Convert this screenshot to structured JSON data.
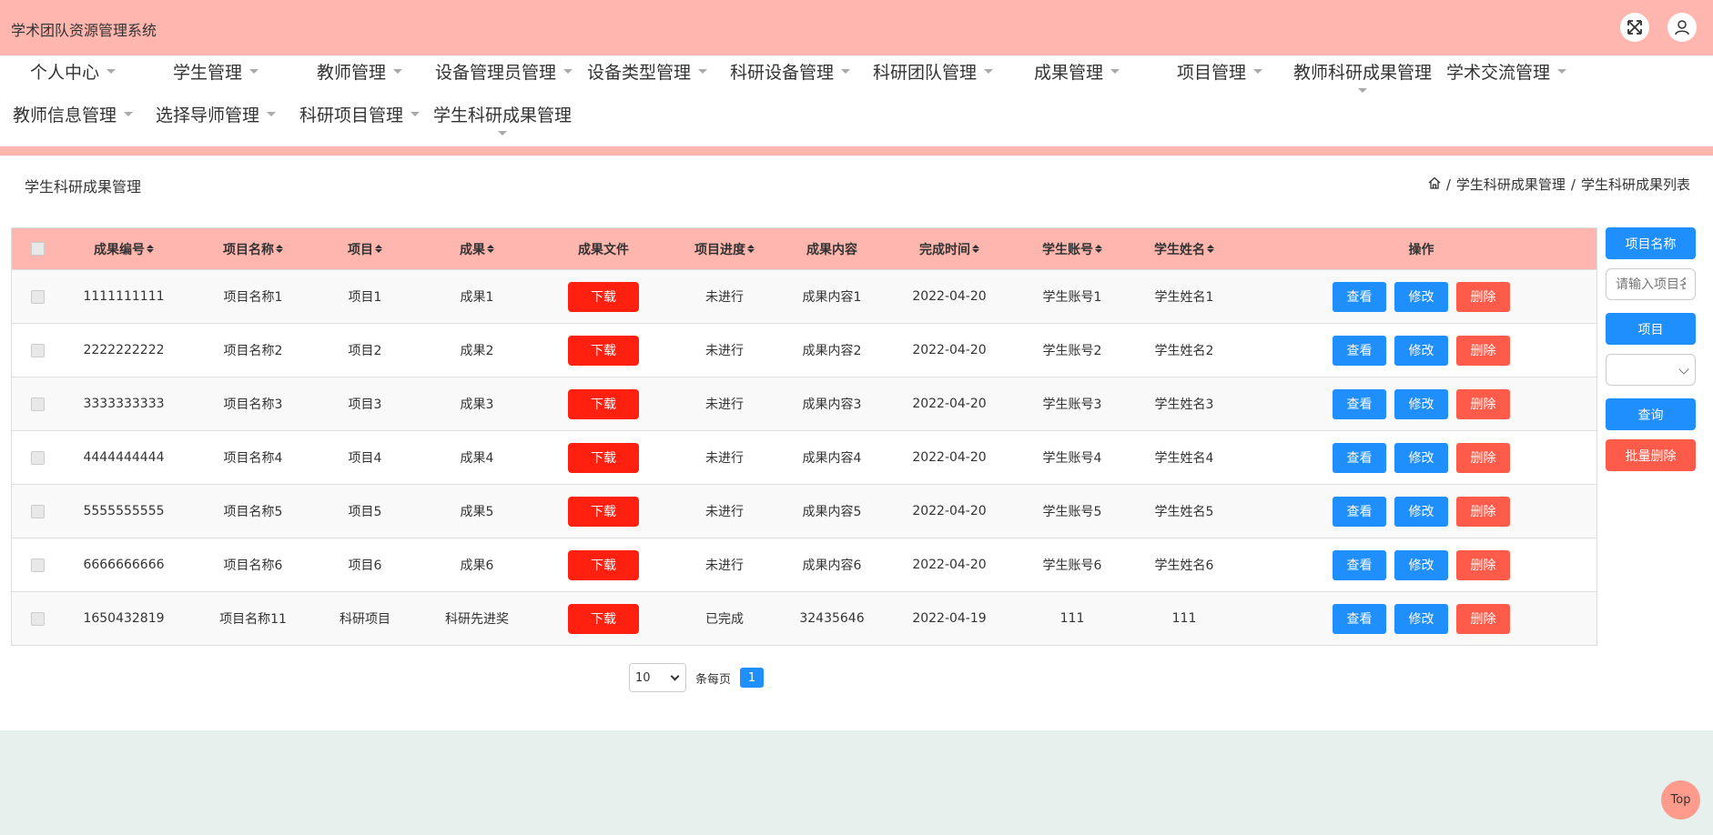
{
  "app": {
    "title": "学术团队资源管理系统"
  },
  "nav": {
    "row1": [
      "个人中心",
      "学生管理",
      "教师管理",
      "设备管理员管理",
      "设备类型管理",
      "科研设备管理",
      "科研团队管理",
      "成果管理",
      "项目管理",
      "教师科研成果管理",
      "学术交流管理"
    ],
    "row2": [
      "教师信息管理",
      "选择导师管理",
      "科研项目管理",
      "学生科研成果管理"
    ]
  },
  "page": {
    "title": "学生科研成果管理",
    "breadcrumb": [
      "学生科研成果管理",
      "学生科研成果列表"
    ]
  },
  "table": {
    "headers": [
      "成果编号",
      "项目名称",
      "项目",
      "成果",
      "成果文件",
      "项目进度",
      "成果内容",
      "完成时间",
      "学生账号",
      "学生姓名",
      "操作"
    ],
    "rows": [
      [
        "1111111111",
        "项目名称1",
        "项目1",
        "成果1",
        "下载",
        "未进行",
        "成果内容1",
        "2022-04-20",
        "学生账号1",
        "学生姓名1"
      ],
      [
        "2222222222",
        "项目名称2",
        "项目2",
        "成果2",
        "下载",
        "未进行",
        "成果内容2",
        "2022-04-20",
        "学生账号2",
        "学生姓名2"
      ],
      [
        "3333333333",
        "项目名称3",
        "项目3",
        "成果3",
        "下载",
        "未进行",
        "成果内容3",
        "2022-04-20",
        "学生账号3",
        "学生姓名3"
      ],
      [
        "4444444444",
        "项目名称4",
        "项目4",
        "成果4",
        "下载",
        "未进行",
        "成果内容4",
        "2022-04-20",
        "学生账号4",
        "学生姓名4"
      ],
      [
        "5555555555",
        "项目名称5",
        "项目5",
        "成果5",
        "下载",
        "未进行",
        "成果内容5",
        "2022-04-20",
        "学生账号5",
        "学生姓名5"
      ],
      [
        "6666666666",
        "项目名称6",
        "项目6",
        "成果6",
        "下载",
        "未进行",
        "成果内容6",
        "2022-04-20",
        "学生账号6",
        "学生姓名6"
      ],
      [
        "1650432819",
        "项目名称11",
        "科研项目",
        "科研先进奖",
        "下载",
        "已完成",
        "32435646",
        "2022-04-19",
        "111",
        "111"
      ]
    ],
    "actions": {
      "view": "查看",
      "edit": "修改",
      "delete": "删除"
    }
  },
  "sidebar": {
    "project_name_label": "项目名称",
    "project_name_placeholder": "请输入项目名称",
    "project_label": "项目",
    "query_label": "查询",
    "batch_delete_label": "批量删除"
  },
  "pager": {
    "page_size": "10",
    "per_page_label": "条每页",
    "current_page": "1"
  },
  "back_to_top": "Top",
  "colors": {
    "header_bg": "#ffb6ae",
    "primary": "#1e8ffc",
    "danger": "#ff5b4a",
    "download": "#ff2010",
    "page_bg": "#e6f0ec"
  }
}
